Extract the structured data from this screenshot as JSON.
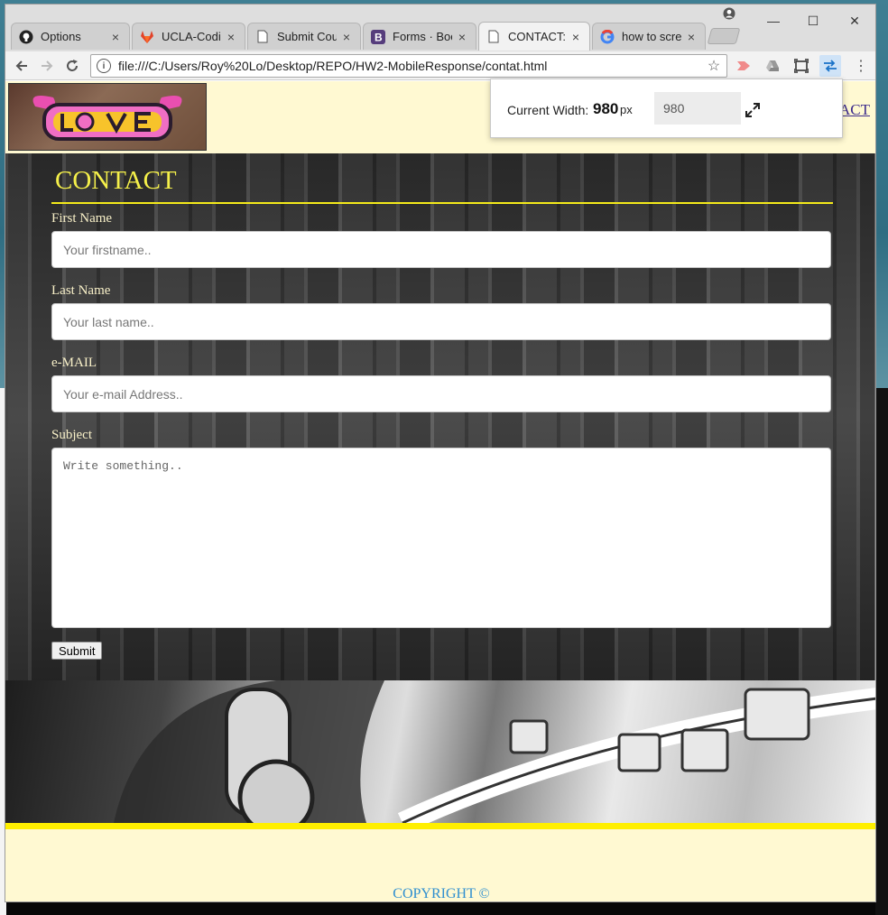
{
  "tabs": [
    {
      "label": "Options",
      "icon": "github-icon"
    },
    {
      "label": "UCLA-Coding",
      "icon": "gitlab-icon"
    },
    {
      "label": "Submit Cour",
      "icon": "page-icon"
    },
    {
      "label": "Forms · Boot",
      "icon": "bootstrap-icon"
    },
    {
      "label": "CONTACT: R",
      "icon": "page-icon",
      "active": true
    },
    {
      "label": "how to scree",
      "icon": "google-icon"
    }
  ],
  "tab_close_glyph": "×",
  "window_controls": {
    "minimize": "—",
    "maximize": "☐",
    "close": "✕"
  },
  "toolbar": {
    "url": "file:///C:/Users/Roy%20Lo/Desktop/REPO/HW2-MobileResponse/contat.html"
  },
  "page": {
    "nav_link": "ACT",
    "contact_title": "CONTACT",
    "fields": {
      "first_name_label": "First Name",
      "first_name_placeholder": "Your firstname..",
      "last_name_label": "Last Name",
      "last_name_placeholder": "Your last name..",
      "email_label": "e-MAIL",
      "email_placeholder": "Your e-mail Address..",
      "subject_label": "Subject",
      "subject_placeholder": "Write something.."
    },
    "submit_label": "Submit",
    "copyright": "COPYRIGHT ©"
  },
  "width_popup": {
    "label": "Current Width:",
    "value": "980",
    "unit": "px",
    "input_value": "980"
  },
  "colors": {
    "page_bg": "#fff9d2",
    "title_yellow": "#f5f04a",
    "rule_yellow": "#f4ea1a",
    "footer_strip": "#ffef00",
    "copyright_blue": "#2f8fd0"
  }
}
